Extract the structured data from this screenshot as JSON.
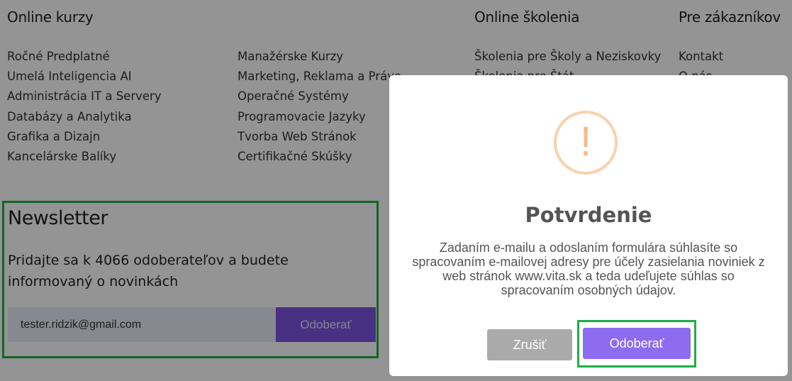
{
  "footer": {
    "columns": [
      {
        "title": "Online kurzy",
        "links": [
          "Ročné Predplatné",
          "Umelá Inteligencia AI",
          "Administrácia IT a Servery",
          "Databázy a Analytika",
          "Grafika a Dizajn",
          "Kancelárske Balíky"
        ]
      },
      {
        "title": "",
        "links": [
          "Manažérske Kurzy",
          "Marketing, Reklama a Právo",
          "Operačné Systémy",
          "Programovacie Jazyky",
          "Tvorba Web Stránok",
          "Certifikačné Skúšky"
        ]
      },
      {
        "title": "Online školenia",
        "links": [
          "Školenia pre Školy a Neziskovky",
          "Školenia pre Štát"
        ]
      },
      {
        "title": "Pre zákazníkov",
        "links": [
          "Kontakt",
          "O nás"
        ]
      }
    ]
  },
  "newsletter": {
    "title": "Newsletter",
    "text": "Pridajte sa k 4066 odoberateľov a budete informovaný o novinkách",
    "email_value": "tester.ridzik@gmail.com",
    "button_label": "Odoberať"
  },
  "modal": {
    "icon": "exclamation-icon",
    "icon_glyph": "!",
    "title": "Potvrdenie",
    "text": "Zadaním e-mailu a odoslaním formulára súhlasíte so spracovaním e-mailovej adresy pre účely zasielania noviniek z web stránok www.vita.sk a teda udeľujete súhlas so spracovaním osobných údajov.",
    "cancel_label": "Zrušiť",
    "confirm_label": "Odoberať"
  },
  "colors": {
    "highlight": "#1fae47",
    "accent": "#8e6cef",
    "warning": "#f7b985"
  }
}
